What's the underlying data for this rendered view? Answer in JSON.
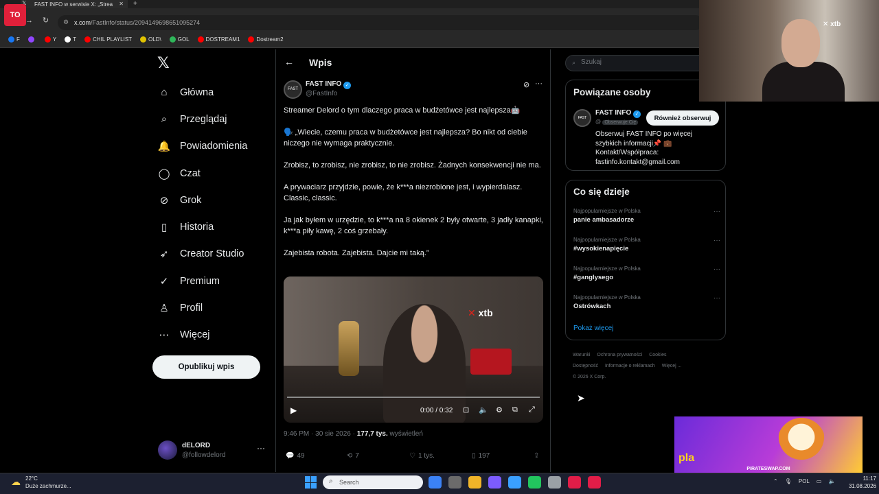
{
  "browser": {
    "tab_title": "FAST INFO w serwisie X: „Strea",
    "url_host": "x.com",
    "url_path": "/FastInfo/status/2094149698651095274",
    "bookmarks": [
      {
        "label": "F",
        "color": "#1877f2"
      },
      {
        "label": "",
        "color": "#9146ff"
      },
      {
        "label": "Y",
        "color": "#ff0000"
      },
      {
        "label": "T",
        "color": "#ffffff"
      },
      {
        "label": "CHIL PLAYLIST",
        "color": "#ff0000"
      },
      {
        "label": "OLD\\",
        "color": "#e0c200"
      },
      {
        "label": "GOL",
        "color": "#2fb65a"
      },
      {
        "label": "DOSTREAM1",
        "color": "#ff0000"
      },
      {
        "label": "Dostream2",
        "color": "#ff0000"
      }
    ]
  },
  "stream_logo": "TO",
  "left_nav": {
    "items": [
      {
        "label": "Główna",
        "icon": "home-icon",
        "glyph": "⌂"
      },
      {
        "label": "Przeglądaj",
        "icon": "search-icon",
        "glyph": "⌕"
      },
      {
        "label": "Powiadomienia",
        "icon": "bell-icon",
        "glyph": "🔔"
      },
      {
        "label": "Czat",
        "icon": "chat-icon",
        "glyph": "◯"
      },
      {
        "label": "Grok",
        "icon": "grok-icon",
        "glyph": "⊘"
      },
      {
        "label": "Historia",
        "icon": "bookmark-icon",
        "glyph": "▯"
      },
      {
        "label": "Creator Studio",
        "icon": "rocket-icon",
        "glyph": "➶"
      },
      {
        "label": "Premium",
        "icon": "verified-icon",
        "glyph": "✓"
      },
      {
        "label": "Profil",
        "icon": "profile-icon",
        "glyph": "♙"
      },
      {
        "label": "Więcej",
        "icon": "more-circle-icon",
        "glyph": "⋯"
      }
    ],
    "post_button": "Opublikuj wpis",
    "account": {
      "name": "dELORD",
      "handle": "@followdelord"
    }
  },
  "post": {
    "header_title": "Wpis",
    "author_name": "FAST INFO",
    "author_handle": "@FastInfo",
    "paragraphs": [
      "Streamer Delord o tym dlaczego praca w budżetówce jest najlepsza🤖",
      "🗣️ „Wiecie, czemu praca w budżetówce jest najlepsza? Bo nikt od ciebie niczego nie wymaga praktycznie.",
      "Zrobisz, to zrobisz, nie zrobisz, to nie zrobisz. Żadnych konsekwencji nie ma.",
      "A prywaciarz przyjdzie, powie, że k***a niezrobione jest, i wypierdalasz. Classic, classic.",
      "Ja jak byłem w urzędzie, to k***a na 8 okienek 2 były otwarte, 3 jadły kanapki, k***a piły kawę, 2 coś grzebały.",
      "Zajebista robota. Zajebista. Dajcie mi taką.”"
    ],
    "video": {
      "time": "0:00 / 0:32",
      "progress": 0,
      "overlay_brand": "xtb"
    },
    "meta_time": "9:46 PM · 30 sie 2026 · ",
    "meta_views": "177,7 tys.",
    "meta_views_label": " wyświetleń",
    "actions": {
      "replies": "49",
      "reposts": "7",
      "likes": "1 tys.",
      "bookmarks": "197"
    }
  },
  "right": {
    "search_placeholder": "Szukaj",
    "related": {
      "title": "Powiązane osoby",
      "name": "FAST INFO",
      "handle": "@",
      "follows_you": "Obserwuje Cię",
      "follow_button": "Również obserwuj",
      "bio": "Obserwuj FAST INFO po więcej szybkich informacji📌 💼 Kontakt/Współpraca: fastinfo.kontakt@gmail.com"
    },
    "trends": {
      "title": "Co się dzieje",
      "items": [
        {
          "context": "Najpopularniejsze w Polska",
          "name": "panie ambasadorze"
        },
        {
          "context": "Najpopularniejsze w Polska",
          "name": "#wysokienapięcie"
        },
        {
          "context": "Najpopularniejsze w Polska",
          "name": "#ganglysego"
        },
        {
          "context": "Najpopularniejsze w Polska",
          "name": "Ostrówkach"
        }
      ],
      "show_more": "Pokaż więcej"
    },
    "footer": [
      "Warunki",
      "Ochrona prywatności",
      "Cookies",
      "Dostępność",
      "Informacje o reklamach",
      "Więcej ...",
      "© 2026 X Corp."
    ]
  },
  "webcam": {
    "brand": "xtb"
  },
  "ad": {
    "url": "PIRATESWAP.COM",
    "logo": "pla"
  },
  "taskbar": {
    "weather_temp": "22°C",
    "weather_desc": "Duże zachmurze...",
    "search_label": "Search",
    "apps": [
      "#3b82f6",
      "#6b6b6b",
      "#f0b429",
      "#7c5cff",
      "#3aa0ff",
      "#22c55e",
      "#9aa0a6",
      "#e11d48",
      "#e11d48"
    ],
    "lang": "POL",
    "time": "11:17",
    "date": "31.08.2026"
  }
}
